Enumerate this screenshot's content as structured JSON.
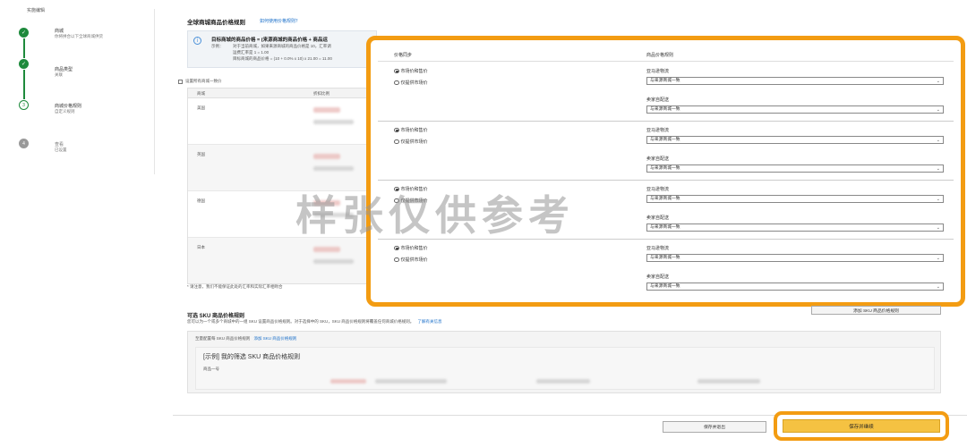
{
  "stepper": {
    "title": "实施编辑",
    "steps": [
      {
        "title": "商城",
        "sub": "你将拼合以下全球商城供货"
      },
      {
        "title": "商品类型",
        "sub": "关联"
      },
      {
        "title": "商城价格规则",
        "sub": "自定义规则"
      },
      {
        "title": "查看",
        "sub": "已设置"
      }
    ],
    "current_step_number": "3",
    "todo_step_number": "4"
  },
  "main": {
    "section_title": "全球商城商品价格规则",
    "section_link": "如何使用价格规则？",
    "info": {
      "headline": "目标商城的商品价格 = (来源商城的商品价格 + 商品运",
      "example_label": "示例：",
      "example_lines": [
        "对于当前商城，如果来源商城的商品价格是 10，汇率调",
        "运费汇率是 1 = 1.00",
        "目标商城的商品价格 = (10 + 0.0% x 10) x 21.00 = 11.00"
      ]
    },
    "checkbox_label": "设置所有商城一致价",
    "left_table": {
      "headers": [
        "商城",
        "折扣比例"
      ],
      "rows": [
        "美国",
        "英国",
        "德国",
        "日本"
      ],
      "footnote": "* 请注意，我们不能保证此处的汇率和实际汇率相吻合"
    }
  },
  "panel": {
    "header_left": "价格同步",
    "header_right": "商品价格规则",
    "rows": [
      {
        "radio_a": "市场价和售价",
        "radio_b": "仅提供市场价",
        "label_a": "亚马逊物流",
        "value_a": "与来源商城一致",
        "label_b": "卖家自配送",
        "value_b": "与来源商城一致"
      },
      {
        "radio_a": "市场价和售价",
        "radio_b": "仅提供市场价",
        "label_a": "亚马逊物流",
        "value_a": "与来源商城一致",
        "label_b": "卖家自配送",
        "value_b": "与来源商城一致"
      },
      {
        "radio_a": "市场价和售价",
        "radio_b": "仅提供市场价",
        "label_a": "亚马逊物流",
        "value_a": "与来源商城一致",
        "label_b": "卖家自配送",
        "value_b": "与来源商城一致"
      },
      {
        "radio_a": "市场价和售价",
        "radio_b": "仅提供市场价",
        "label_a": "亚马逊物流",
        "value_a": "与来源商城一致",
        "label_b": "卖家自配送",
        "value_b": "与来源商城一致"
      }
    ]
  },
  "sku": {
    "title": "可选 SKU 商品价格规则",
    "description": "您可以为一个或多个商城中的一组 SKU 设置商品价格规则。对于选择中的 SKU，SKU 商品价格规则将覆盖任何商城价格规则。",
    "learn_more": "了解有关信息",
    "add_button": "添加 SKU 商品价格规则",
    "tabs_label": "至量配置每 SKU 商品价格规则",
    "tabs_link": "添加 SKU 商品价格规则",
    "example_title": "[示例] 我的筛选 SKU 商品价格规则",
    "example_sub": "商品一号"
  },
  "footer": {
    "save_draft": "保存并退出",
    "save_continue": "保存并继续"
  },
  "watermark": "样张仅供参考",
  "colors": {
    "accent": "#f39c12",
    "success": "#1e8a3c",
    "primary_button": "#f5c242",
    "link": "#1a6fc9"
  }
}
